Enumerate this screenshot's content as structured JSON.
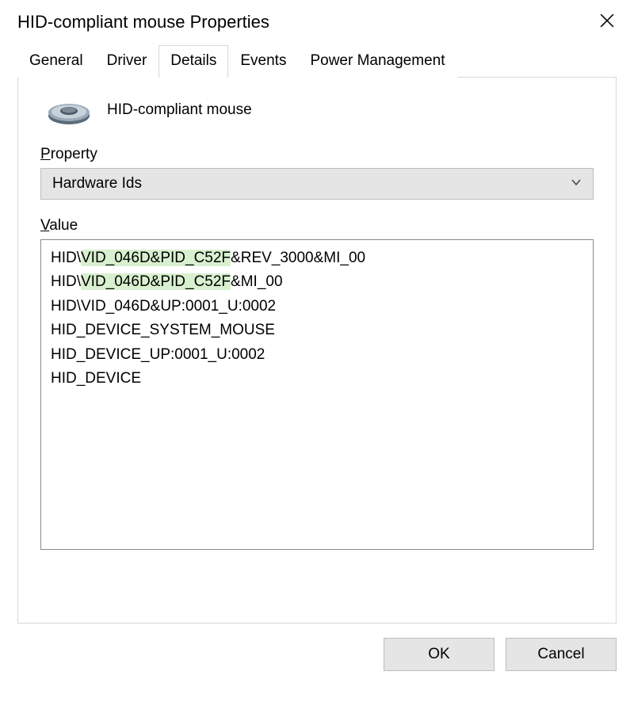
{
  "title": "HID-compliant mouse Properties",
  "tabs": [
    {
      "label": "General"
    },
    {
      "label": "Driver"
    },
    {
      "label": "Details"
    },
    {
      "label": "Events"
    },
    {
      "label": "Power Management"
    }
  ],
  "active_tab_index": 2,
  "device_name": "HID-compliant mouse",
  "property_label_prefix": "P",
  "property_label_rest": "roperty",
  "property_selected": "Hardware Ids",
  "value_label_prefix": "V",
  "value_label_rest": "alue",
  "values": [
    {
      "pre": "HID\\",
      "hl": "VID_046D&PID_C52F",
      "post": "&REV_3000&MI_00"
    },
    {
      "pre": "HID\\",
      "hl": "VID_046D&PID_C52F",
      "post": "&MI_00"
    },
    {
      "pre": "HID\\VID_046D&UP:0001_U:0002",
      "hl": "",
      "post": ""
    },
    {
      "pre": "HID_DEVICE_SYSTEM_MOUSE",
      "hl": "",
      "post": ""
    },
    {
      "pre": "HID_DEVICE_UP:0001_U:0002",
      "hl": "",
      "post": ""
    },
    {
      "pre": "HID_DEVICE",
      "hl": "",
      "post": ""
    }
  ],
  "buttons": {
    "ok": "OK",
    "cancel": "Cancel"
  }
}
